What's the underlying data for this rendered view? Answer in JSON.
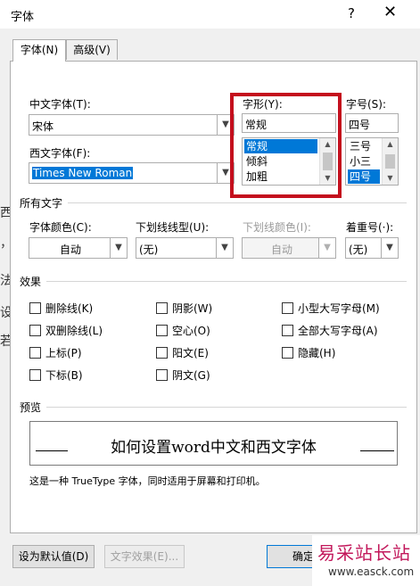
{
  "window": {
    "title": "字体",
    "help": "?",
    "close": "✕"
  },
  "tabs": [
    {
      "label": "字体(N)"
    },
    {
      "label": "高级(V)"
    }
  ],
  "font": {
    "cjk_label": "中文字体(T):",
    "cjk_value": "宋体",
    "latin_label": "西文字体(F):",
    "latin_value": "Times New Roman",
    "style_label": "字形(Y):",
    "style_value": "常规",
    "style_options": [
      "常规",
      "倾斜",
      "加粗"
    ],
    "size_label": "字号(S):",
    "size_value": "四号",
    "size_options": [
      "三号",
      "小三",
      "四号"
    ]
  },
  "all_text": {
    "section": "所有文字",
    "color_label": "字体颜色(C):",
    "color_value": "自动",
    "underline_label": "下划线线型(U):",
    "underline_value": "(无)",
    "underline_color_label": "下划线颜色(I):",
    "underline_color_value": "自动",
    "emphasis_label": "着重号(·):",
    "emphasis_value": "(无)"
  },
  "effects": {
    "section": "效果",
    "items": [
      {
        "label": "删除线(K)"
      },
      {
        "label": "阴影(W)"
      },
      {
        "label": "小型大写字母(M)"
      },
      {
        "label": "双删除线(L)"
      },
      {
        "label": "空心(O)"
      },
      {
        "label": "全部大写字母(A)"
      },
      {
        "label": "上标(P)"
      },
      {
        "label": "阳文(E)"
      },
      {
        "label": "隐藏(H)"
      },
      {
        "label": "下标(B)"
      },
      {
        "label": "阴文(G)"
      }
    ]
  },
  "preview": {
    "section": "预览",
    "sample": "如何设置word中文和西文字体",
    "note": "这是一种 TrueType 字体，同时适用于屏幕和打印机。"
  },
  "buttons": {
    "default": "设为默认值(D)",
    "text_effects": "文字效果(E)...",
    "ok": "确定"
  },
  "outside_text": [
    "西",
    "，",
    "法",
    "设",
    "若"
  ],
  "watermark": {
    "text": "易采站长站",
    "url": "www.easck.com"
  },
  "colors": {
    "accent": "#0078d7",
    "highlight_box": "#c40e1d",
    "watermark": "#c2185b"
  },
  "icons": {
    "dropdown": "chevron-down-icon",
    "scroll_up": "scroll-up-icon",
    "scroll_down": "scroll-down-icon"
  }
}
